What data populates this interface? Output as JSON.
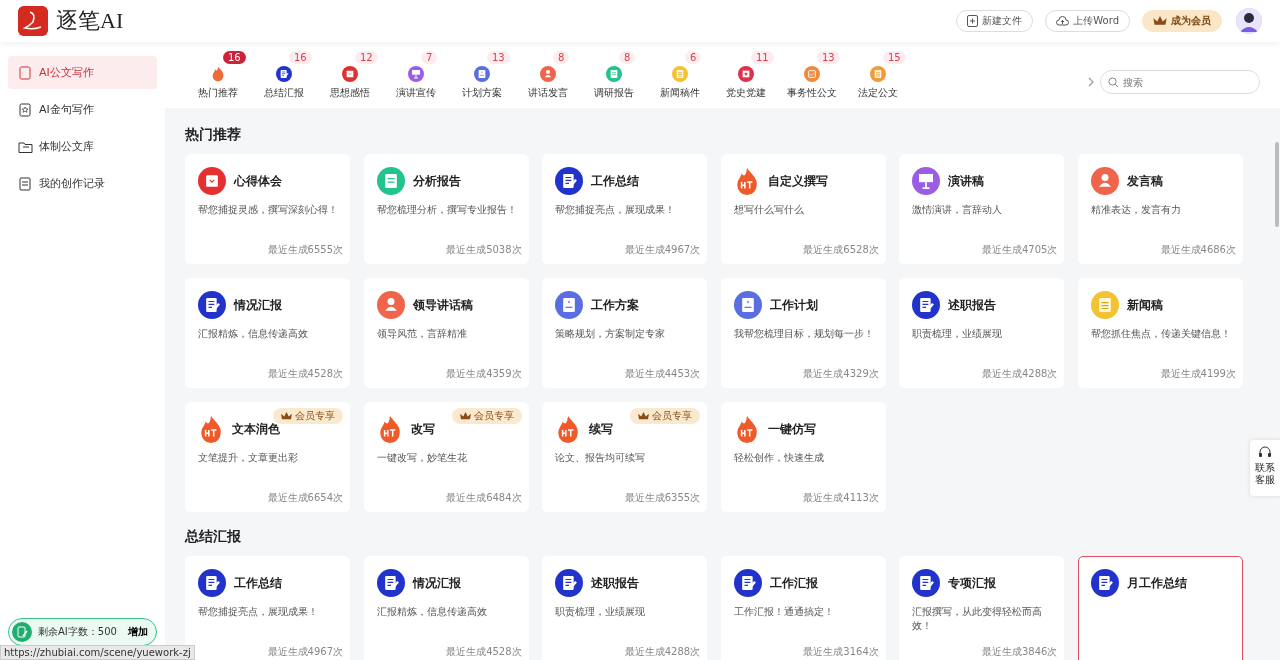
{
  "header": {
    "brand": "逐笔AI",
    "buttons": [
      {
        "kind": "new",
        "label": "新建文件"
      },
      {
        "kind": "upload",
        "label": "上传Word"
      },
      {
        "kind": "member",
        "label": "成为会员"
      }
    ]
  },
  "sidebar": {
    "items": [
      {
        "kind": "ai",
        "label": "AI公文写作",
        "selected": true
      },
      {
        "kind": "star",
        "label": "AI金句写作",
        "selected": false
      },
      {
        "kind": "folder",
        "label": "体制公文库",
        "selected": false
      },
      {
        "kind": "record",
        "label": "我的创作记录",
        "selected": false
      }
    ],
    "quota": {
      "label": "剩余AI字数：500",
      "action": "增加"
    }
  },
  "categories": [
    {
      "kind": "flame",
      "color": "#f06a35",
      "label": "热门推荐",
      "count": "16",
      "selected": true
    },
    {
      "kind": "pen",
      "color": "#2233cc",
      "label": "总结汇报",
      "count": "16",
      "selected": false
    },
    {
      "kind": "note",
      "color": "#e03030",
      "label": "思想感悟",
      "count": "12",
      "selected": false
    },
    {
      "kind": "easel",
      "color": "#9b5de5",
      "label": "演讲宣传",
      "count": "7",
      "selected": false
    },
    {
      "kind": "book",
      "color": "#5b6ee1",
      "label": "计划方案",
      "count": "13",
      "selected": false
    },
    {
      "kind": "person",
      "color": "#f0644c",
      "label": "讲话发言",
      "count": "8",
      "selected": false
    },
    {
      "kind": "doc",
      "color": "#22c38e",
      "label": "调研报告",
      "count": "8",
      "selected": false
    },
    {
      "kind": "news",
      "color": "#f2c230",
      "label": "新闻稿件",
      "count": "6",
      "selected": false
    },
    {
      "kind": "party",
      "color": "#e0304a",
      "label": "党史党建",
      "count": "11",
      "selected": false
    },
    {
      "kind": "task",
      "color": "#f08a3c",
      "label": "事务性公文",
      "count": "13",
      "selected": false
    },
    {
      "kind": "news",
      "color": "#f09a3c",
      "label": "法定公文",
      "count": "15",
      "selected": false
    }
  ],
  "search": {
    "placeholder": "搜索"
  },
  "sections": [
    {
      "title": "热门推荐",
      "cards": [
        {
          "kind": "note",
          "title": "心得体会",
          "desc": "帮您捕捉灵感，撰写深刻心得！",
          "count": "最近生成6555次",
          "selected": false
        },
        {
          "kind": "doc",
          "title": "分析报告",
          "desc": "帮您梳理分析，撰写专业报告！",
          "count": "最近生成5038次",
          "selected": false
        },
        {
          "kind": "pen",
          "title": "工作总结",
          "desc": "帮您捕捉亮点，展现成果！",
          "count": "最近生成4967次",
          "selected": false
        },
        {
          "kind": "flame",
          "title": "自定义撰写",
          "desc": "想写什么写什么",
          "count": "最近生成6528次",
          "selected": false
        },
        {
          "kind": "easel",
          "title": "演讲稿",
          "desc": "激情演讲，言辞动人",
          "count": "最近生成4705次",
          "selected": false
        },
        {
          "kind": "person",
          "title": "发言稿",
          "desc": "精准表达，发言有力",
          "count": "最近生成4686次",
          "selected": false
        },
        {
          "kind": "pen",
          "title": "情况汇报",
          "desc": "汇报精炼，信息传递高效",
          "count": "最近生成4528次",
          "selected": false
        },
        {
          "kind": "person",
          "title": "领导讲话稿",
          "desc": "领导风范，言辞精准",
          "count": "最近生成4359次",
          "selected": false
        },
        {
          "kind": "book",
          "title": "工作方案",
          "desc": "策略规划，方案制定专家",
          "count": "最近生成4453次",
          "selected": false
        },
        {
          "kind": "book",
          "title": "工作计划",
          "desc": "我帮您梳理目标，规划每一步！",
          "count": "最近生成4329次",
          "selected": false
        },
        {
          "kind": "pen",
          "title": "述职报告",
          "desc": "职责梳理，业绩展现",
          "count": "最近生成4288次",
          "selected": false
        },
        {
          "kind": "news",
          "title": "新闻稿",
          "desc": "帮您抓住焦点，传递关键信息！",
          "count": "最近生成4199次",
          "selected": false
        },
        {
          "kind": "flame",
          "title": "文本润色",
          "desc": "文笔提升，文章更出彩",
          "count": "最近生成6654次",
          "badge": "会员专享",
          "selected": false
        },
        {
          "kind": "flame",
          "title": "改写",
          "desc": "一键改写，妙笔生花",
          "count": "最近生成6484次",
          "badge": "会员专享",
          "selected": false
        },
        {
          "kind": "flame",
          "title": "续写",
          "desc": "论文、报告均可续写",
          "count": "最近生成6355次",
          "badge": "会员专享",
          "selected": false
        },
        {
          "kind": "flame",
          "title": "一键仿写",
          "desc": "轻松创作，快速生成",
          "count": "最近生成4113次",
          "selected": false
        }
      ]
    },
    {
      "title": "总结汇报",
      "cards": [
        {
          "kind": "pen",
          "title": "工作总结",
          "desc": "帮您捕捉亮点，展现成果！",
          "count": "最近生成4967次",
          "selected": false
        },
        {
          "kind": "pen",
          "title": "情况汇报",
          "desc": "汇报精炼，信息传递高效",
          "count": "最近生成4528次",
          "selected": false
        },
        {
          "kind": "pen",
          "title": "述职报告",
          "desc": "职责梳理，业绩展现",
          "count": "最近生成4288次",
          "selected": false
        },
        {
          "kind": "pen",
          "title": "工作汇报",
          "desc": "工作汇报！通通搞定！",
          "count": "最近生成3164次",
          "selected": false
        },
        {
          "kind": "pen",
          "title": "专项汇报",
          "desc": "汇报撰写，从此变得轻松而高效！",
          "count": "最近生成3846次",
          "selected": false
        },
        {
          "kind": "pen",
          "title": "月工作总结",
          "selected": true
        }
      ]
    }
  ],
  "service": {
    "label": "联系客服"
  },
  "status_url": "https://zhubiai.com/scene/yuework-zj"
}
